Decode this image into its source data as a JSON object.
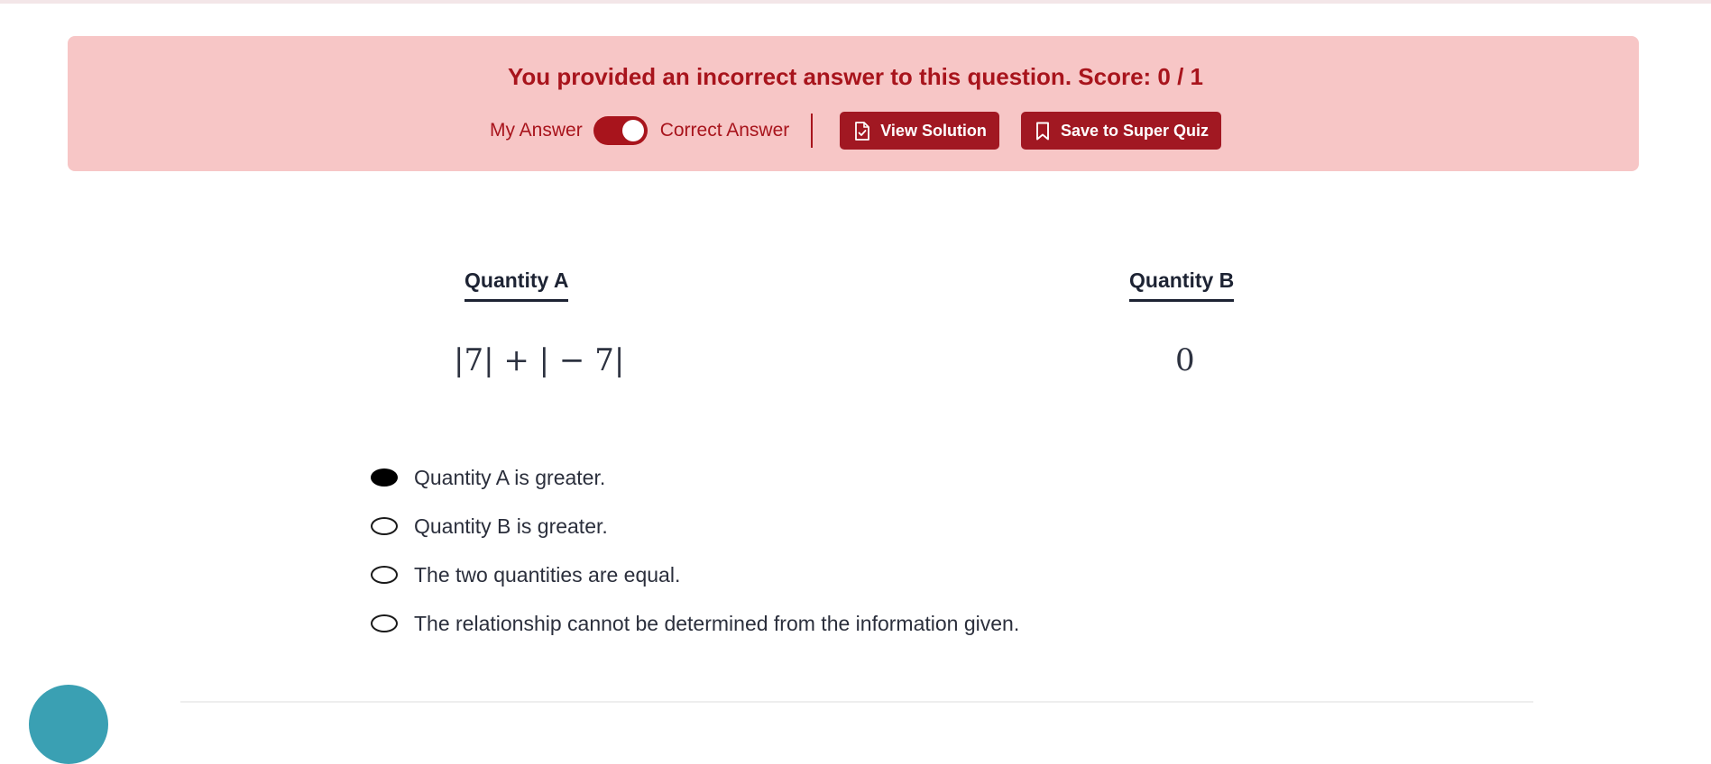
{
  "banner": {
    "message": "You provided an incorrect answer to this question. Score: 0 / 1",
    "toggle": {
      "left_label": "My Answer",
      "right_label": "Correct Answer",
      "state": "correct"
    },
    "buttons": {
      "view_solution": "View Solution",
      "save_super_quiz": "Save to Super Quiz"
    }
  },
  "question": {
    "quantity_a": {
      "label": "Quantity A",
      "value": "|7| + | − 7|"
    },
    "quantity_b": {
      "label": "Quantity B",
      "value": "0"
    }
  },
  "options": [
    {
      "label": "Quantity A is greater.",
      "selected": true
    },
    {
      "label": "Quantity B is greater.",
      "selected": false
    },
    {
      "label": "The two quantities are equal.",
      "selected": false
    },
    {
      "label": "The relationship cannot be determined from the information given.",
      "selected": false
    }
  ],
  "colors": {
    "banner_bg": "#f7c6c6",
    "accent": "#a8141c",
    "button_bg": "#a11822",
    "text_dark": "#1d2333",
    "fab": "#3aa0b3"
  },
  "icons": {
    "view_solution": "document-check-icon",
    "save_super_quiz": "bookmark-icon"
  }
}
